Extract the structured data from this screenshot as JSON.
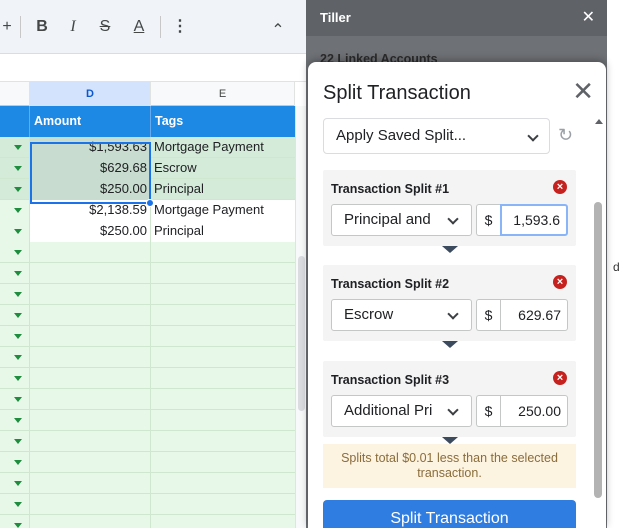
{
  "toolbar": {
    "icons": [
      "plus-icon",
      "bold-icon",
      "italic-icon",
      "strikethrough-icon",
      "text-color-icon",
      "more-vert-icon",
      "chevron-up-icon"
    ],
    "plus": "+",
    "bold": "B",
    "italic": "I",
    "strike": "S",
    "text_color": "A",
    "more": "⋮",
    "collapse": "⌃"
  },
  "sheet": {
    "columns": [
      "D",
      "E"
    ],
    "headers": {
      "amount": "Amount",
      "tags": "Tags"
    },
    "rows": [
      {
        "amount": "$1,593.63",
        "tags": "Mortgage Payment",
        "style": "hl"
      },
      {
        "amount": "$629.68",
        "tags": "Escrow",
        "style": "hl"
      },
      {
        "amount": "$250.00",
        "tags": "Principal",
        "style": "hl"
      },
      {
        "amount": "$2,138.59",
        "tags": "Mortgage Payment",
        "style": "white"
      },
      {
        "amount": "$250.00",
        "tags": "Principal",
        "style": "white"
      }
    ],
    "empty_rows": 14
  },
  "tiller": {
    "title": "Tiller",
    "close": "✕",
    "linked_accounts": "22 Linked Accounts",
    "edge_letter": "d"
  },
  "modal": {
    "title": "Split Transaction",
    "close": "✕",
    "apply_saved": "Apply Saved Split...",
    "refresh_icon": "↻",
    "currency": "$",
    "splits": [
      {
        "label": "Transaction Split #1",
        "category": "Principal and",
        "amount": "1,593.6",
        "focused": true
      },
      {
        "label": "Transaction Split #2",
        "category": "Escrow",
        "amount": "629.67",
        "focused": false
      },
      {
        "label": "Transaction Split #3",
        "category": "Additional Pri",
        "amount": "250.00",
        "focused": false
      }
    ],
    "delete_glyph": "×",
    "notice": "Splits total $0.01 less than the selected transaction.",
    "button": "Split Transaction"
  }
}
